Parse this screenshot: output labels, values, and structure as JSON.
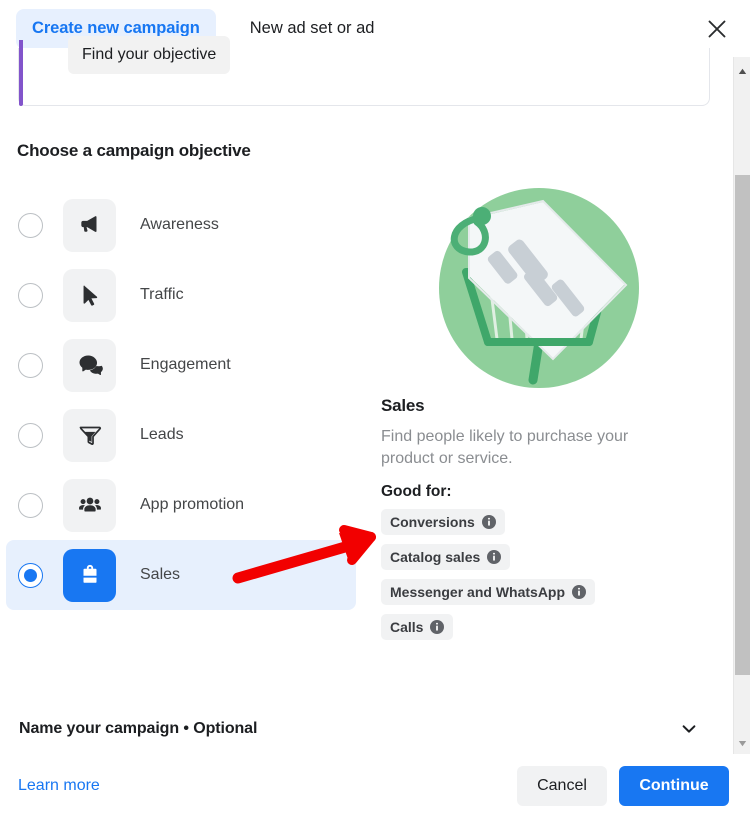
{
  "header": {
    "active_tab": "Create new campaign",
    "inactive_tab": "New ad set or ad",
    "close_icon": "close-icon"
  },
  "top_card": {
    "chip_label": "Find your objective",
    "accent_color": "#8254cb"
  },
  "main": {
    "section_title": "Choose a campaign objective",
    "objectives": [
      {
        "label": "Awareness",
        "icon": "megaphone-icon",
        "selected": false
      },
      {
        "label": "Traffic",
        "icon": "cursor-arrow-icon",
        "selected": false
      },
      {
        "label": "Engagement",
        "icon": "speech-bubbles-icon",
        "selected": false
      },
      {
        "label": "Leads",
        "icon": "funnel-icon",
        "selected": false
      },
      {
        "label": "App promotion",
        "icon": "people-group-icon",
        "selected": false
      },
      {
        "label": "Sales",
        "icon": "shopping-bag-icon",
        "selected": true
      }
    ]
  },
  "detail": {
    "illustration": "shopping-cart-with-price-tag-illustration",
    "title": "Sales",
    "description": "Find people likely to purchase your product or service.",
    "good_for_label": "Good for:",
    "tags": [
      "Conversions",
      "Catalog sales",
      "Messenger and WhatsApp",
      "Calls"
    ]
  },
  "name_section": {
    "label": "Name your campaign • Optional",
    "chevron_icon": "chevron-down-icon"
  },
  "footer": {
    "learn_more": "Learn more",
    "cancel": "Cancel",
    "continue": "Continue"
  },
  "colors": {
    "brand_blue": "#1877f2",
    "selected_row_bg": "#e7f0fd",
    "annotation_red": "#f20000",
    "illustration_green": "#8fcf9b"
  }
}
